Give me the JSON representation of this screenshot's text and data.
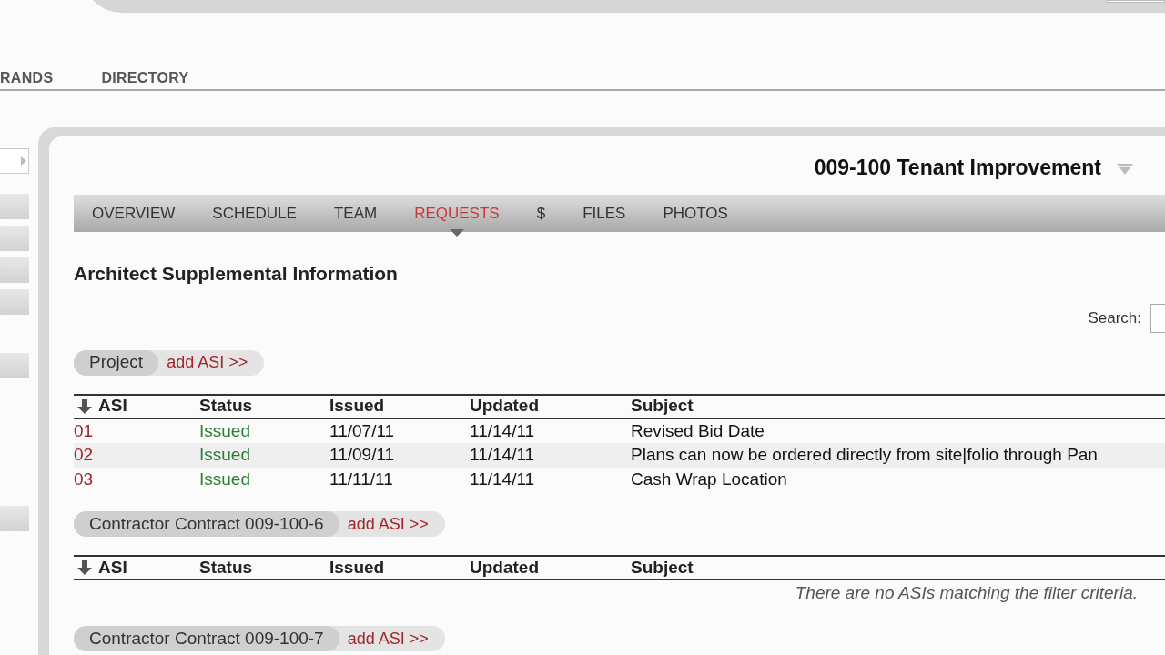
{
  "top_nav": [
    {
      "label": "RANDS"
    },
    {
      "label": "DIRECTORY"
    }
  ],
  "project_title": "009-100 Tenant Improvement",
  "tabs": [
    {
      "label": "OVERVIEW",
      "selected": false
    },
    {
      "label": "SCHEDULE",
      "selected": false
    },
    {
      "label": "TEAM",
      "selected": false
    },
    {
      "label": "REQUESTS",
      "selected": true
    },
    {
      "label": "$",
      "selected": false
    },
    {
      "label": "FILES",
      "selected": false
    },
    {
      "label": "PHOTOS",
      "selected": false
    }
  ],
  "heading": "Architect Supplemental Information",
  "search": {
    "label": "Search:"
  },
  "sections": [
    {
      "name": "Project",
      "action": "add ASI >>",
      "columns": [
        "ASI",
        "Status",
        "Issued",
        "Updated",
        "Subject"
      ],
      "rows": [
        {
          "asi": "01",
          "status": "Issued",
          "issued": "11/07/11",
          "updated": "11/14/11",
          "subject": "Revised Bid Date"
        },
        {
          "asi": "02",
          "status": "Issued",
          "issued": "11/09/11",
          "updated": "11/14/11",
          "subject": "Plans can now be ordered directly from site|folio through Pan"
        },
        {
          "asi": "03",
          "status": "Issued",
          "issued": "11/11/11",
          "updated": "11/14/11",
          "subject": "Cash Wrap Location"
        }
      ]
    },
    {
      "name": "Contractor Contract 009-100-6",
      "action": "add ASI >>",
      "columns": [
        "ASI",
        "Status",
        "Issued",
        "Updated",
        "Subject"
      ],
      "empty_message": "There are no ASIs matching the filter criteria."
    },
    {
      "name": "Contractor Contract 009-100-7",
      "action": "add ASI >>"
    }
  ]
}
